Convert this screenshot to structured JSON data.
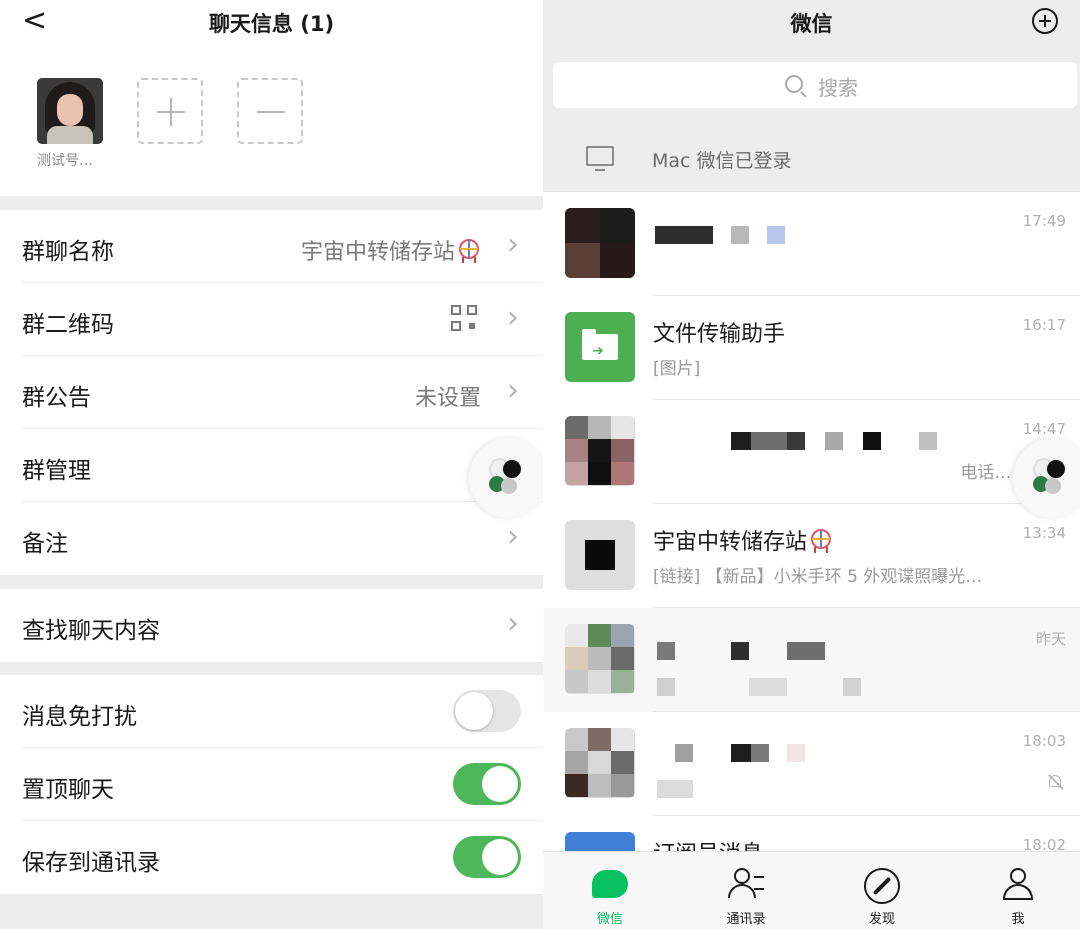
{
  "left": {
    "title": "聊天信息 (1)",
    "back_glyph": "<",
    "member": {
      "name": "测试号…"
    },
    "rows": {
      "group_name": {
        "label": "群聊名称",
        "value": "宇宙中转储存站"
      },
      "qr": {
        "label": "群二维码"
      },
      "notice": {
        "label": "群公告",
        "value": "未设置"
      },
      "manage": {
        "label": "群管理"
      },
      "remark": {
        "label": "备注"
      },
      "search_chat": {
        "label": "查找聊天内容"
      },
      "mute": {
        "label": "消息免打扰",
        "state": "off"
      },
      "pin": {
        "label": "置顶聊天",
        "state": "on"
      },
      "save_contacts": {
        "label": "保存到通讯录",
        "state": "on"
      }
    },
    "chevron": "›"
  },
  "right": {
    "title": "微信",
    "search_placeholder": "搜索",
    "mac_login": "Mac 微信已登录",
    "chats": [
      {
        "name": "",
        "preview": "",
        "time": "17:49"
      },
      {
        "name": "文件传输助手",
        "preview": "[图片]",
        "time": "16:17"
      },
      {
        "name": "",
        "preview": "　 电话…",
        "time": "14:47"
      },
      {
        "name": "宇宙中转储存站",
        "preview": "[链接] 【新品】小米手环 5 外观谍照曝光…",
        "time": "13:34"
      },
      {
        "name": "",
        "preview": "",
        "time": "昨天"
      },
      {
        "name": "",
        "preview": "",
        "time": "18:03"
      },
      {
        "name": "订阅号消息",
        "preview": "",
        "time": "18:02"
      }
    ],
    "tabs": {
      "chats": "微信",
      "contacts": "通讯录",
      "discover": "发现",
      "me": "我"
    },
    "accent_color": "#07c160",
    "toggle_on_color": "#4eb75a"
  },
  "icons": {
    "back": "chevron-left-icon",
    "add": "plus-circle-icon",
    "search": "search-icon",
    "mac": "monitor-icon",
    "qr": "qr-code-icon",
    "assistive": "floating-ball-icon",
    "mute": "muted-bell-icon",
    "file": "folder-transfer-icon"
  }
}
